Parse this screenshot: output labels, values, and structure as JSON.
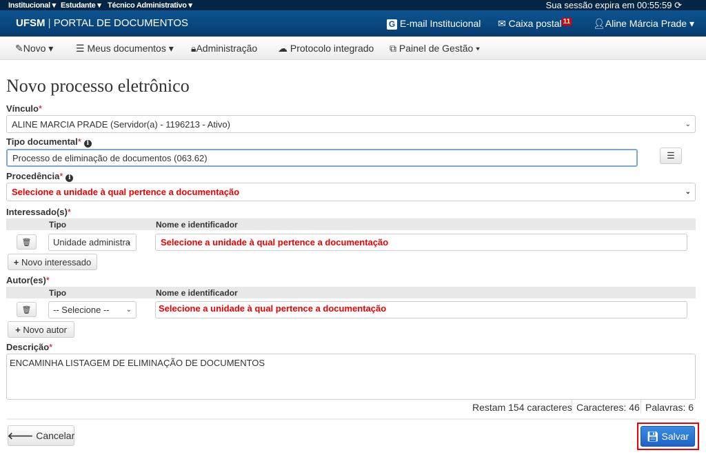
{
  "topbar": {
    "menus": [
      "Institucional",
      "Estudante",
      "Técnico Administrativo"
    ],
    "session": "Sua sessão expira em 00:55:59"
  },
  "header": {
    "logo_strong": "UFSM",
    "logo_text": "PORTAL DE DOCUMENTOS",
    "email": "E-mail Institucional",
    "mailbox": "Caixa postal",
    "mailbox_count": "11",
    "user": "Aline Márcia Prade"
  },
  "nav": {
    "items": [
      "Novo",
      "Meus documentos",
      "Administração",
      "Protocolo integrado",
      "Painel de Gestão"
    ]
  },
  "page": {
    "title": "Novo processo eletrônico"
  },
  "form": {
    "vinculo": {
      "label": "Vínculo",
      "value": "ALINE MARCIA PRADE (Servidor(a) - 1196213 - Ativo)"
    },
    "tipo": {
      "label": "Tipo documental",
      "value": "Processo de eliminação de documentos (063.62)"
    },
    "procedencia": {
      "label": "Procedência",
      "value": "Selecione a unidade à qual pertence a documentação"
    },
    "interessados": {
      "label": "Interessado(s)",
      "col_tipo": "Tipo",
      "col_nome": "Nome e identificador",
      "tipo_value": "Unidade administra",
      "nome_value": "Selecione a unidade à qual pertence a documentação",
      "add": "Novo interessado"
    },
    "autores": {
      "label": "Autor(es)",
      "col_tipo": "Tipo",
      "col_nome": "Nome e identificador",
      "tipo_value": "-- Selecione --",
      "nome_value": "Selecione a unidade à qual pertence a documentação",
      "add": "Novo autor"
    },
    "descricao": {
      "label": "Descrição",
      "value": "ENCAMINHA LISTAGEM DE ELIMINAÇÃO DE DOCUMENTOS",
      "restam": "Restam 154 caracteres",
      "caracteres": "Caracteres: 46",
      "palavras": "Palavras: 6"
    }
  },
  "actions": {
    "cancel": "Cancelar",
    "save": "Salvar"
  }
}
